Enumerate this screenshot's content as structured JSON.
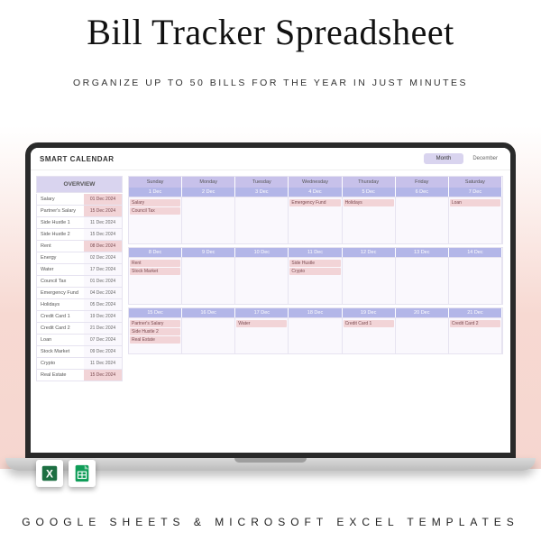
{
  "title": "Bill Tracker Spreadsheet",
  "subtitle": "ORGANIZE UP TO 50 BILLS FOR THE YEAR IN JUST MINUTES",
  "footer": "GOOGLE SHEETS & MICROSOFT EXCEL TEMPLATES",
  "app": {
    "header": "SMART CALENDAR",
    "view_button": "Month",
    "month_label": "December"
  },
  "overview": {
    "heading": "OVERVIEW",
    "rows": [
      {
        "name": "Salary",
        "date": "01 Dec 2024",
        "hl": true
      },
      {
        "name": "Partner's Salary",
        "date": "15 Dec 2024",
        "hl": true
      },
      {
        "name": "Side Hustle 1",
        "date": "11 Dec 2024",
        "hl": false
      },
      {
        "name": "Side Hustle 2",
        "date": "15 Dec 2024",
        "hl": false
      },
      {
        "name": "Rent",
        "date": "08 Dec 2024",
        "hl": true
      },
      {
        "name": "Energy",
        "date": "02 Dec 2024",
        "hl": false
      },
      {
        "name": "Water",
        "date": "17 Dec 2024",
        "hl": false
      },
      {
        "name": "Council Tax",
        "date": "01 Dec 2024",
        "hl": false
      },
      {
        "name": "Emergency Fund",
        "date": "04 Dec 2024",
        "hl": false
      },
      {
        "name": "Holidays",
        "date": "05 Dec 2024",
        "hl": false
      },
      {
        "name": "Credit Card 1",
        "date": "19 Dec 2024",
        "hl": false
      },
      {
        "name": "Credit Card 2",
        "date": "21 Dec 2024",
        "hl": false
      },
      {
        "name": "Loan",
        "date": "07 Dec 2024",
        "hl": false
      },
      {
        "name": "Stock Market",
        "date": "09 Dec 2024",
        "hl": false
      },
      {
        "name": "Crypto",
        "date": "11 Dec 2024",
        "hl": false
      },
      {
        "name": "Real Estate",
        "date": "15 Dec 2024",
        "hl": true
      }
    ]
  },
  "calendar": {
    "day_labels": [
      "Sunday",
      "Monday",
      "Tuesday",
      "Wednesday",
      "Thursday",
      "Friday",
      "Saturday"
    ],
    "weeks": [
      {
        "dates": [
          "1 Dec",
          "2 Dec",
          "3 Dec",
          "4 Dec",
          "5 Dec",
          "6 Dec",
          "7 Dec"
        ],
        "events": [
          [
            "Salary",
            "Council Tax"
          ],
          [
            ""
          ],
          [
            ""
          ],
          [
            "Emergency Fund"
          ],
          [
            "Holidays"
          ],
          [
            ""
          ],
          [
            "Loan"
          ]
        ]
      },
      {
        "dates": [
          "8 Dec",
          "9 Dec",
          "10 Dec",
          "11 Dec",
          "12 Dec",
          "13 Dec",
          "14 Dec"
        ],
        "events": [
          [
            "Rent",
            "Stock Market"
          ],
          [
            ""
          ],
          [
            ""
          ],
          [
            "Side Hustle",
            "Crypto"
          ],
          [
            ""
          ],
          [
            ""
          ],
          [
            ""
          ]
        ]
      },
      {
        "dates": [
          "15 Dec",
          "16 Dec",
          "17 Dec",
          "18 Dec",
          "19 Dec",
          "20 Dec",
          "21 Dec"
        ],
        "events": [
          [
            "Partner's Salary",
            "Side Hustle 2",
            "Real Estate"
          ],
          [
            ""
          ],
          [
            "Water"
          ],
          [
            ""
          ],
          [
            "Credit Card 1"
          ],
          [
            ""
          ],
          [
            "Credit Card 2"
          ]
        ]
      }
    ]
  }
}
